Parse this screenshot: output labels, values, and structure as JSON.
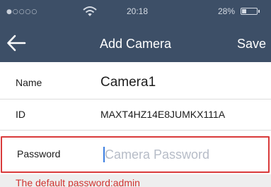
{
  "status_bar": {
    "signal": "●○○○○",
    "time": "20:18",
    "battery_percent": "28%",
    "battery_level": 0.28,
    "wifi_icon": "wifi-icon"
  },
  "navbar": {
    "back_icon": "arrow-left-icon",
    "title": "Add Camera",
    "save_label": "Save"
  },
  "form": {
    "name": {
      "label": "Name",
      "value": "Camera1"
    },
    "id": {
      "label": "ID",
      "value": "MAXT4HZ14E8JUMKX111A"
    },
    "password": {
      "label": "Password",
      "value": "",
      "placeholder": "Camera Password"
    }
  },
  "hint": "The default password:admin",
  "colors": {
    "navbar_bg": "#3d4f67",
    "highlight_border": "#d93a3a",
    "hint_text": "#d0332f",
    "caret": "#3b7ee0"
  }
}
